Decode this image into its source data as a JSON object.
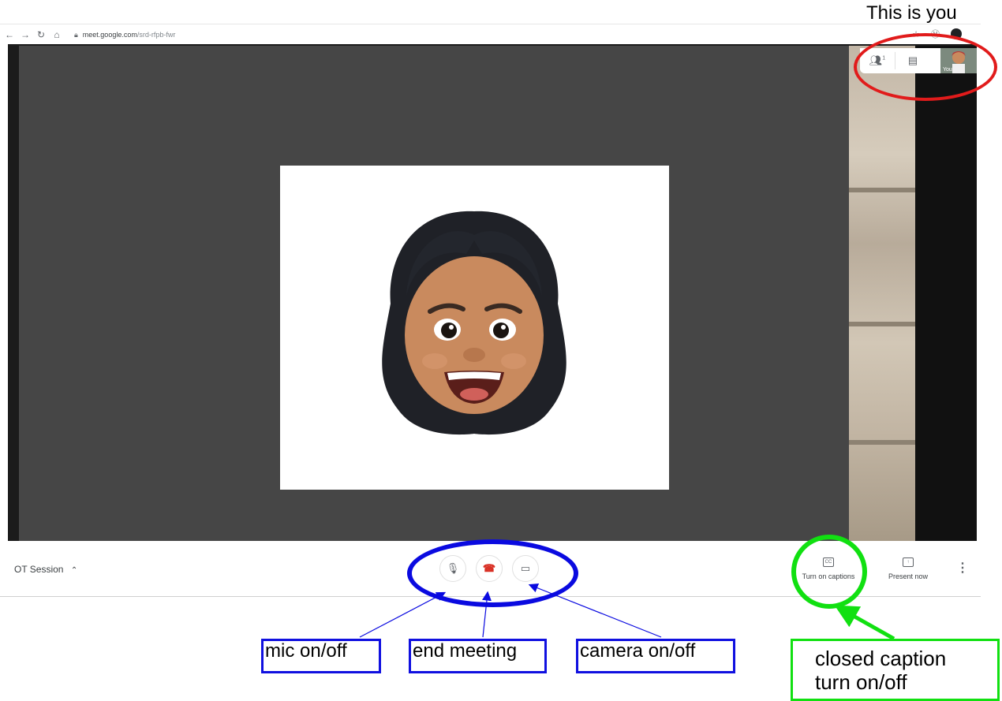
{
  "annotation": {
    "this_is_you": "This is you",
    "mic_label": "mic on/off",
    "end_label": "end meeting",
    "camera_label": "camera on/off",
    "caption_line1": "closed caption",
    "caption_line2": "turn on/off"
  },
  "browser": {
    "url_domain": "meet.google.com",
    "url_path": "/srd-rfpb-fwr"
  },
  "meeting": {
    "title": "OT Session",
    "self_tile_label": "You",
    "participants_count": "1"
  },
  "controls": {
    "captions_label": "Turn on captions",
    "present_label": "Present now"
  },
  "colors": {
    "annotation_red": "#e11b1b",
    "annotation_blue": "#0a0ae0",
    "annotation_green": "#11e011",
    "end_call_red": "#d93025"
  },
  "icons": [
    "back-arrow-icon",
    "forward-arrow-icon",
    "reload-icon",
    "home-icon",
    "lock-icon",
    "star-icon",
    "extension-icon",
    "profile-icon",
    "people-icon",
    "chat-icon",
    "mic-icon",
    "end-call-icon",
    "camera-icon",
    "captions-icon",
    "present-icon",
    "more-vert-icon",
    "chevron-up-icon"
  ]
}
